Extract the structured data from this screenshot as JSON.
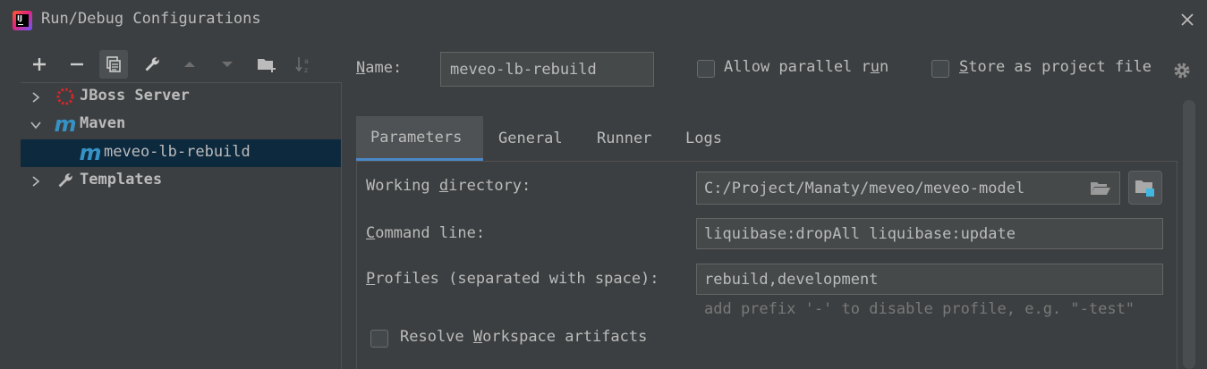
{
  "window": {
    "title": "Run/Debug Configurations",
    "app_icon_text": "IJ"
  },
  "toolbar": {
    "buttons": [
      "add-icon",
      "remove-icon",
      "copy-icon",
      "wrench-icon",
      "arrow-up-icon",
      "arrow-down-icon",
      "folder-add-icon",
      "sort-az-icon"
    ]
  },
  "tree": {
    "items": [
      {
        "label": "JBoss Server",
        "expanded": false
      },
      {
        "label": "Maven",
        "expanded": true
      },
      {
        "label": "meveo-lb-rebuild",
        "selected": true
      },
      {
        "label": "Templates",
        "expanded": false
      }
    ]
  },
  "header": {
    "name_label_u": "N",
    "name_label_rest": "ame:",
    "name_value": "meveo-lb-rebuild",
    "parallel_pre": "Allow parallel r",
    "parallel_u": "u",
    "parallel_post": "n",
    "store_u": "S",
    "store_rest": "tore as project file"
  },
  "tabs": [
    "Parameters",
    "General",
    "Runner",
    "Logs"
  ],
  "fields": {
    "working_dir_pre": "Working ",
    "working_dir_u": "d",
    "working_dir_post": "irectory:",
    "working_dir_value": "C:/Project/Manaty/meveo/meveo-model",
    "command_u": "C",
    "command_rest": "ommand line:",
    "command_value": "liquibase:dropAll liquibase:update",
    "profiles_u": "P",
    "profiles_rest": "rofiles (separated with space):",
    "profiles_value": "rebuild,development",
    "profiles_hint": "add prefix '-' to disable profile, e.g. \"-test\"",
    "resolve_pre": "Resolve ",
    "resolve_u": "W",
    "resolve_post": "orkspace artifacts"
  },
  "colors": {
    "background": "#3c3f41",
    "selection": "#0d293e",
    "tab_underline": "#4a88c7",
    "maven_blue": "#3592c4",
    "jboss_red": "#d8262c"
  }
}
